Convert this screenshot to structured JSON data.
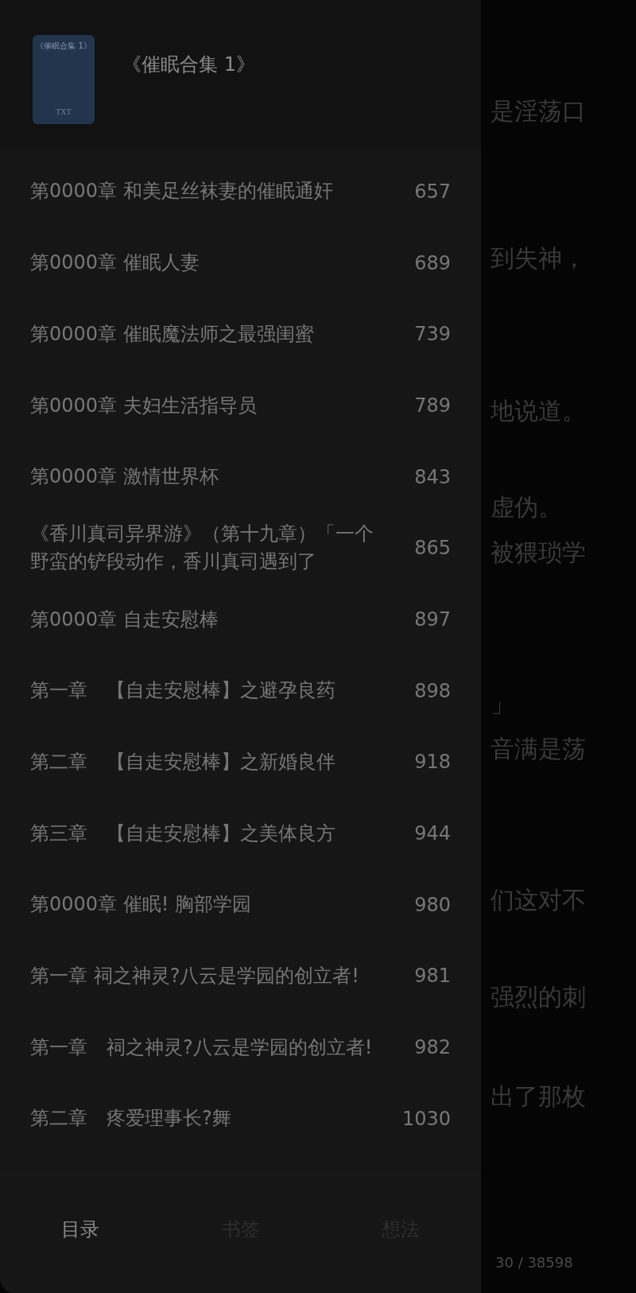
{
  "reader": {
    "lines": [
      "是淫荡口",
      "到失神，",
      "地说道。",
      "虚伪。",
      "被猥琐学",
      "」",
      "音满是荡",
      "们这对不",
      "强烈的刺",
      "出了那枚"
    ],
    "progress": "30 / 38598"
  },
  "book": {
    "cover_title": "《催眠合集 1》",
    "cover_format": "TXT",
    "title": "《催眠合集 1》"
  },
  "chapters": [
    {
      "title": "第0000章 和美足丝袜妻的催眠通奸",
      "page": "657"
    },
    {
      "title": "第0000章 催眠人妻",
      "page": "689"
    },
    {
      "title": "第0000章 催眠魔法师之最强闺蜜",
      "page": "739"
    },
    {
      "title": "第0000章 夫妇生活指导员",
      "page": "789"
    },
    {
      "title": "第0000章 激情世界杯",
      "page": "843"
    },
    {
      "title": "《香川真司异界游》（第十九章）「一个野蛮的铲段动作，香川真司遇到了",
      "page": "865"
    },
    {
      "title": "第0000章 自走安慰棒",
      "page": "897"
    },
    {
      "title": "第一章　【自走安慰棒】之避孕良药",
      "page": "898"
    },
    {
      "title": "第二章　【自走安慰棒】之新婚良伴",
      "page": "918"
    },
    {
      "title": "第三章　【自走安慰棒】之美体良方",
      "page": "944"
    },
    {
      "title": "第0000章 催眠! 胸部学园",
      "page": "980"
    },
    {
      "title": "第一章 祠之神灵?八云是学园的创立者!",
      "page": "981"
    },
    {
      "title": "第一章　祠之神灵?八云是学园的创立者!",
      "page": "982"
    },
    {
      "title": "第二章　疼爱理事长?舞",
      "page": "1030"
    }
  ],
  "tabs": [
    {
      "label": "目录",
      "selected": true
    },
    {
      "label": "书签",
      "selected": false
    },
    {
      "label": "想法",
      "selected": false
    }
  ]
}
